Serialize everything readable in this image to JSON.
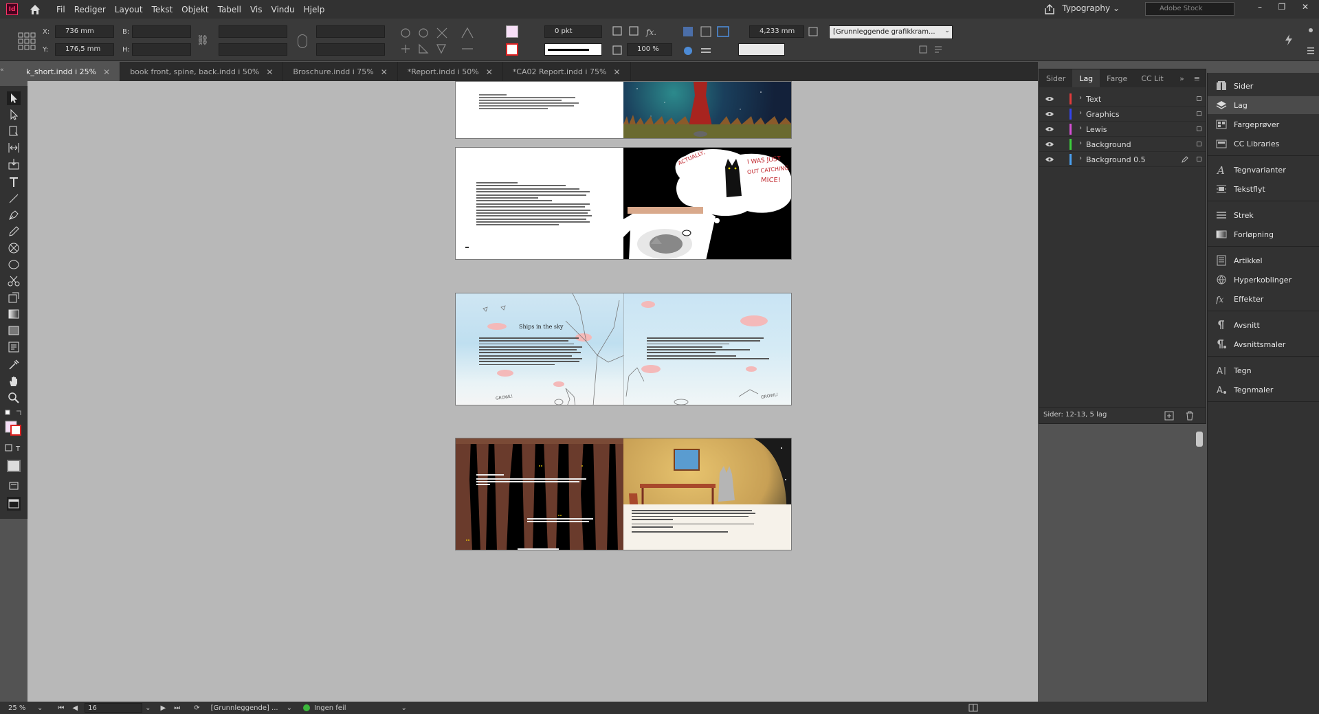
{
  "app": {
    "badge": "Id",
    "menu": [
      "Fil",
      "Rediger",
      "Layout",
      "Tekst",
      "Objekt",
      "Tabell",
      "Vis",
      "Vindu",
      "Hjelp"
    ],
    "workspace": "Typography",
    "stock_placeholder": "Adobe Stock"
  },
  "control": {
    "x_label": "X:",
    "x_value": "736 mm",
    "y_label": "Y:",
    "y_value": "176,5 mm",
    "w_label": "B:",
    "h_label": "H:",
    "stroke_weight": "0 pkt",
    "opacity": "100 %",
    "spacing": "4,233 mm",
    "style": "[Grunnleggende grafikkram..."
  },
  "tabs": [
    {
      "label": "k_short.indd i 25%",
      "active": true
    },
    {
      "label": "book front, spine, back.indd i 50%",
      "active": false
    },
    {
      "label": "Broschure.indd i 75%",
      "active": false
    },
    {
      "label": "*Report.indd i 50%",
      "active": false
    },
    {
      "label": "*CA02 Report.indd i 75%",
      "active": false
    }
  ],
  "layers_panel": {
    "tabs": [
      "Sider",
      "Lag",
      "Farge",
      "CC Lit"
    ],
    "layers": [
      {
        "name": "Text",
        "color": "#e23b3b"
      },
      {
        "name": "Graphics",
        "color": "#3344ee"
      },
      {
        "name": "Lewis",
        "color": "#d64fd6"
      },
      {
        "name": "Background",
        "color": "#3ccf3c"
      },
      {
        "name": "Background 0.5",
        "color": "#4aa0f0"
      }
    ],
    "footer": "Sider: 12-13, 5 lag"
  },
  "right_panels": [
    {
      "label": "Sider",
      "icon": "pages-icon"
    },
    {
      "label": "Lag",
      "icon": "layers-icon",
      "active": true
    },
    {
      "label": "Fargeprøver",
      "icon": "swatches-icon"
    },
    {
      "label": "CC Libraries",
      "icon": "libraries-icon"
    },
    {
      "label": "Tegnvarianter",
      "icon": "glyphs-icon"
    },
    {
      "label": "Tekstflyt",
      "icon": "textwrap-icon"
    },
    {
      "label": "Strek",
      "icon": "stroke-icon"
    },
    {
      "label": "Forløpning",
      "icon": "gradient-icon"
    },
    {
      "label": "Artikkel",
      "icon": "article-icon"
    },
    {
      "label": "Hyperkoblinger",
      "icon": "hyperlinks-icon"
    },
    {
      "label": "Effekter",
      "icon": "effects-icon"
    },
    {
      "label": "Avsnitt",
      "icon": "paragraph-icon"
    },
    {
      "label": "Avsnittsmaler",
      "icon": "paragraph-styles-icon"
    },
    {
      "label": "Tegn",
      "icon": "character-icon"
    },
    {
      "label": "Tegnmaler",
      "icon": "character-styles-icon"
    }
  ],
  "spreads": {
    "s2_heading": "Ships in the sky",
    "s2_growl_left": "GROWL!",
    "s2_growl_right": "GROWL!",
    "s1_bubble_a": "ACTUALLY,",
    "s1_bubble_b": "I WAS JUST",
    "s1_bubble_c": "OUT CATCHING",
    "s1_bubble_d": "MICE!"
  },
  "status": {
    "zoom": "25 %",
    "page": "16",
    "preflight_profile": "[Grunnleggende] ...",
    "preflight": "Ingen feil"
  }
}
